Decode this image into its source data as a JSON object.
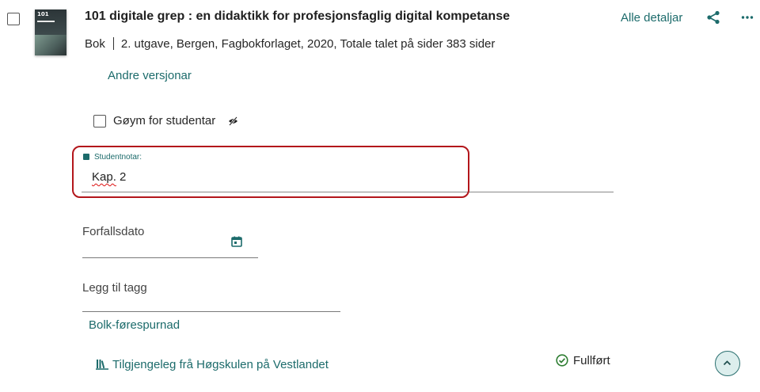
{
  "record": {
    "title": "101 digitale grep : en didaktikk for profesjonsfaglig digital kompetanse",
    "type": "Bok",
    "details": "2. utgave, Bergen, Fagbokforlaget, 2020, Totale talet på sider 383 sider",
    "cover_text": "101",
    "other_versions": "Andre versjonar"
  },
  "actions": {
    "all_details": "Alle detaljar",
    "share_icon": "share-icon",
    "more_icon": "more-horizontal-icon"
  },
  "student_visibility": {
    "label": "Gøym for studentar",
    "checked": false
  },
  "student_note": {
    "label": "Studentnotar:",
    "value_misspelled": "Kap.",
    "value_rest": " 2"
  },
  "due_date": {
    "label": "Forfallsdato",
    "value": ""
  },
  "tags": {
    "label": "Legg til tagg",
    "value": ""
  },
  "bulk_request": "Bolk-førespurnad",
  "availability": "Tilgjengeleg frå Høgskulen på Vestlandet",
  "status": "Fullført",
  "colors": {
    "accent": "#1c6b6b",
    "highlight": "#b3161b",
    "collapse_bg": "#dceeed"
  }
}
